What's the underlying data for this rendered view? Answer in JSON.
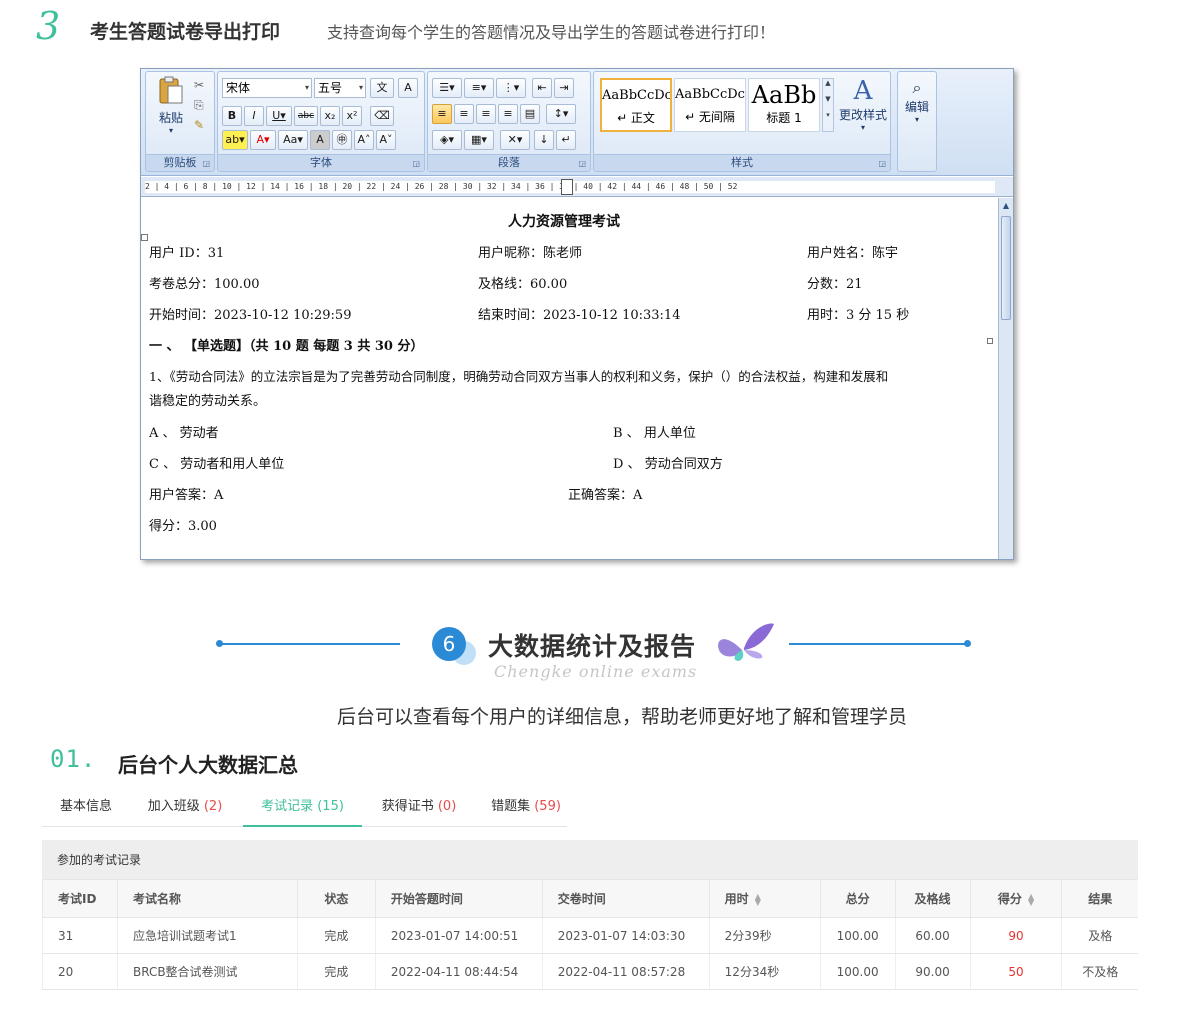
{
  "section3": {
    "number": "3",
    "title": "考生答题试卷导出打印",
    "desc": "支持查询每个学生的答题情况及导出学生的答题试卷进行打印！"
  },
  "word": {
    "ribbon": {
      "clipboard": {
        "paste": "粘贴",
        "label": "剪贴板"
      },
      "font": {
        "name": "宋体",
        "size": "五号",
        "label": "字体"
      },
      "paragraph": {
        "label": "段落"
      },
      "styles": {
        "label": "样式",
        "items": [
          {
            "sample": "AaBbCcDc",
            "name": "↵ 正文"
          },
          {
            "sample": "AaBbCcDc",
            "name": "↵ 无间隔"
          },
          {
            "sample": "AaBb",
            "name": "标题 1"
          }
        ],
        "change": "更改样式"
      },
      "edit": {
        "label": "编辑"
      }
    },
    "ruler": "2 | 4 | 6 | 8 | 10 | 12 | 14 | 16 | 18 | 20 | 22 | 24 | 26 | 28 | 30 | 32 | 34 | 36 | 38 | 40 | 42 | 44 | 46 | 48 | 50 | 52",
    "doc": {
      "title": "人力资源管理考试",
      "user_id": "用户 ID：31",
      "nickname": "用户昵称：陈老师",
      "realname": "用户姓名：陈宇",
      "total": "考卷总分：100.00",
      "pass": "及格线：60.00",
      "score": "分数：21",
      "start": "开始时间：2023-10-12 10:29:59",
      "end": "结束时间：2023-10-12 10:33:14",
      "duration": "用时：3 分 15 秒",
      "section": "一 、 【单选题】（共 10 题  每题 3  共 30 分）",
      "q1_line1": "1、《劳动合同法》的立法宗旨是为了完善劳动合同制度，明确劳动合同双方当事人的权利和义务，保护（）的合法权益，构建和发展和",
      "q1_line2": "谐稳定的劳动关系。",
      "opt_a": "A 、  劳动者",
      "opt_b": "B 、  用人单位",
      "opt_c": "C 、  劳动者和用人单位",
      "opt_d": "D 、  劳动合同双方",
      "user_answer": "用户答案：A",
      "correct_answer": "正确答案：A",
      "got": "得分：3.00"
    }
  },
  "section6": {
    "number": "6",
    "title": "大数据统计及报告",
    "subtitle": "Chengke online exams",
    "desc": "后台可以查看每个用户的详细信息，帮助老师更好地了解和管理学员"
  },
  "sub01": {
    "number": "01.",
    "title": "后台个人大数据汇总"
  },
  "tabs": [
    {
      "label": "基本信息",
      "count": ""
    },
    {
      "label": "加入班级",
      "count": "(2)"
    },
    {
      "label": "考试记录",
      "count": "(15)"
    },
    {
      "label": "获得证书",
      "count": "(0)"
    },
    {
      "label": "错题集",
      "count": "(59)"
    }
  ],
  "records": {
    "panel_title": "参加的考试记录",
    "headers": [
      "考试ID",
      "考试名称",
      "状态",
      "开始答题时间",
      "交卷时间",
      "用时",
      "总分",
      "及格线",
      "得分",
      "结果"
    ],
    "rows": [
      [
        "31",
        "应急培训试题考试1",
        "完成",
        "2023-01-07 14:00:51",
        "2023-01-07 14:03:30",
        "2分39秒",
        "100.00",
        "60.00",
        "90",
        "及格"
      ],
      [
        "20",
        "BRCB整合试卷测试",
        "完成",
        "2022-04-11 08:44:54",
        "2022-04-11 08:57:28",
        "12分34秒",
        "100.00",
        "90.00",
        "50",
        "不及格"
      ]
    ]
  },
  "colors": {
    "accent_green": "#3fbf9b",
    "accent_blue": "#2b8ad6",
    "score_red": "#e53333"
  }
}
